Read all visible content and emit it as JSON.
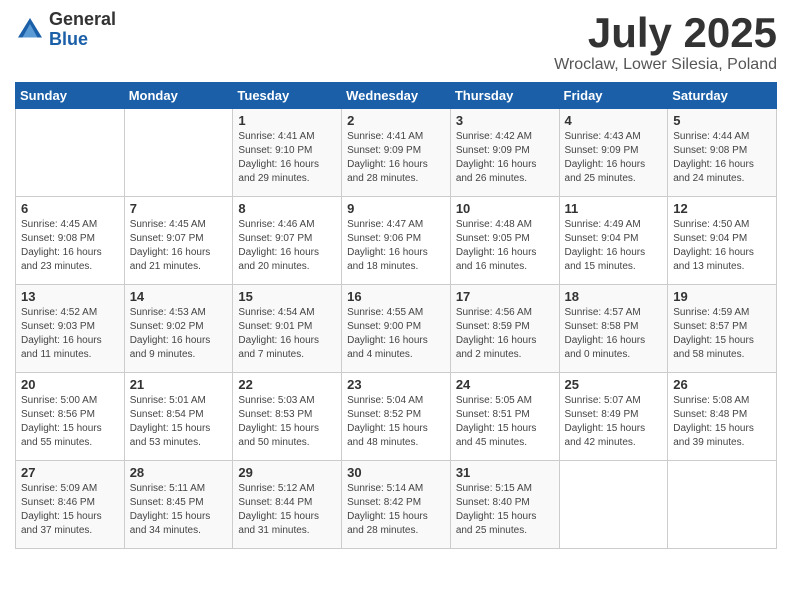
{
  "logo": {
    "general": "General",
    "blue": "Blue"
  },
  "title": {
    "month": "July 2025",
    "location": "Wroclaw, Lower Silesia, Poland"
  },
  "weekdays": [
    "Sunday",
    "Monday",
    "Tuesday",
    "Wednesday",
    "Thursday",
    "Friday",
    "Saturday"
  ],
  "weeks": [
    [
      {
        "day": "",
        "info": ""
      },
      {
        "day": "",
        "info": ""
      },
      {
        "day": "1",
        "info": "Sunrise: 4:41 AM\nSunset: 9:10 PM\nDaylight: 16 hours\nand 29 minutes."
      },
      {
        "day": "2",
        "info": "Sunrise: 4:41 AM\nSunset: 9:09 PM\nDaylight: 16 hours\nand 28 minutes."
      },
      {
        "day": "3",
        "info": "Sunrise: 4:42 AM\nSunset: 9:09 PM\nDaylight: 16 hours\nand 26 minutes."
      },
      {
        "day": "4",
        "info": "Sunrise: 4:43 AM\nSunset: 9:09 PM\nDaylight: 16 hours\nand 25 minutes."
      },
      {
        "day": "5",
        "info": "Sunrise: 4:44 AM\nSunset: 9:08 PM\nDaylight: 16 hours\nand 24 minutes."
      }
    ],
    [
      {
        "day": "6",
        "info": "Sunrise: 4:45 AM\nSunset: 9:08 PM\nDaylight: 16 hours\nand 23 minutes."
      },
      {
        "day": "7",
        "info": "Sunrise: 4:45 AM\nSunset: 9:07 PM\nDaylight: 16 hours\nand 21 minutes."
      },
      {
        "day": "8",
        "info": "Sunrise: 4:46 AM\nSunset: 9:07 PM\nDaylight: 16 hours\nand 20 minutes."
      },
      {
        "day": "9",
        "info": "Sunrise: 4:47 AM\nSunset: 9:06 PM\nDaylight: 16 hours\nand 18 minutes."
      },
      {
        "day": "10",
        "info": "Sunrise: 4:48 AM\nSunset: 9:05 PM\nDaylight: 16 hours\nand 16 minutes."
      },
      {
        "day": "11",
        "info": "Sunrise: 4:49 AM\nSunset: 9:04 PM\nDaylight: 16 hours\nand 15 minutes."
      },
      {
        "day": "12",
        "info": "Sunrise: 4:50 AM\nSunset: 9:04 PM\nDaylight: 16 hours\nand 13 minutes."
      }
    ],
    [
      {
        "day": "13",
        "info": "Sunrise: 4:52 AM\nSunset: 9:03 PM\nDaylight: 16 hours\nand 11 minutes."
      },
      {
        "day": "14",
        "info": "Sunrise: 4:53 AM\nSunset: 9:02 PM\nDaylight: 16 hours\nand 9 minutes."
      },
      {
        "day": "15",
        "info": "Sunrise: 4:54 AM\nSunset: 9:01 PM\nDaylight: 16 hours\nand 7 minutes."
      },
      {
        "day": "16",
        "info": "Sunrise: 4:55 AM\nSunset: 9:00 PM\nDaylight: 16 hours\nand 4 minutes."
      },
      {
        "day": "17",
        "info": "Sunrise: 4:56 AM\nSunset: 8:59 PM\nDaylight: 16 hours\nand 2 minutes."
      },
      {
        "day": "18",
        "info": "Sunrise: 4:57 AM\nSunset: 8:58 PM\nDaylight: 16 hours\nand 0 minutes."
      },
      {
        "day": "19",
        "info": "Sunrise: 4:59 AM\nSunset: 8:57 PM\nDaylight: 15 hours\nand 58 minutes."
      }
    ],
    [
      {
        "day": "20",
        "info": "Sunrise: 5:00 AM\nSunset: 8:56 PM\nDaylight: 15 hours\nand 55 minutes."
      },
      {
        "day": "21",
        "info": "Sunrise: 5:01 AM\nSunset: 8:54 PM\nDaylight: 15 hours\nand 53 minutes."
      },
      {
        "day": "22",
        "info": "Sunrise: 5:03 AM\nSunset: 8:53 PM\nDaylight: 15 hours\nand 50 minutes."
      },
      {
        "day": "23",
        "info": "Sunrise: 5:04 AM\nSunset: 8:52 PM\nDaylight: 15 hours\nand 48 minutes."
      },
      {
        "day": "24",
        "info": "Sunrise: 5:05 AM\nSunset: 8:51 PM\nDaylight: 15 hours\nand 45 minutes."
      },
      {
        "day": "25",
        "info": "Sunrise: 5:07 AM\nSunset: 8:49 PM\nDaylight: 15 hours\nand 42 minutes."
      },
      {
        "day": "26",
        "info": "Sunrise: 5:08 AM\nSunset: 8:48 PM\nDaylight: 15 hours\nand 39 minutes."
      }
    ],
    [
      {
        "day": "27",
        "info": "Sunrise: 5:09 AM\nSunset: 8:46 PM\nDaylight: 15 hours\nand 37 minutes."
      },
      {
        "day": "28",
        "info": "Sunrise: 5:11 AM\nSunset: 8:45 PM\nDaylight: 15 hours\nand 34 minutes."
      },
      {
        "day": "29",
        "info": "Sunrise: 5:12 AM\nSunset: 8:44 PM\nDaylight: 15 hours\nand 31 minutes."
      },
      {
        "day": "30",
        "info": "Sunrise: 5:14 AM\nSunset: 8:42 PM\nDaylight: 15 hours\nand 28 minutes."
      },
      {
        "day": "31",
        "info": "Sunrise: 5:15 AM\nSunset: 8:40 PM\nDaylight: 15 hours\nand 25 minutes."
      },
      {
        "day": "",
        "info": ""
      },
      {
        "day": "",
        "info": ""
      }
    ]
  ]
}
